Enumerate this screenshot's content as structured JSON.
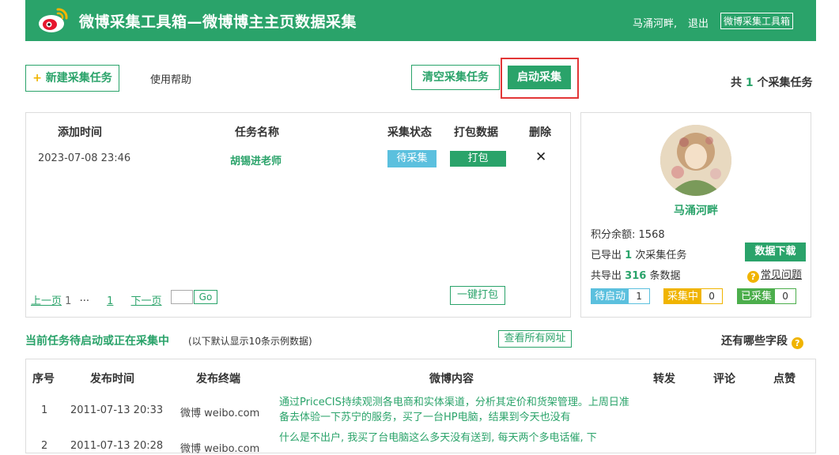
{
  "header": {
    "title": "微博采集工具箱—微博博主主页数据采集",
    "user": "马涌河畔",
    "separator": ",",
    "logout": "退出",
    "toolbox": "微博采集工具箱"
  },
  "toolbar": {
    "new_task_icon": "+",
    "new_task": "新建采集任务",
    "help": "使用帮助",
    "clear": "清空采集任务",
    "start": "启动采集",
    "count_prefix": "共",
    "count": "1",
    "count_suffix": "个采集任务"
  },
  "task_table": {
    "headers": [
      "添加时间",
      "任务名称",
      "采集状态",
      "打包数据",
      "删除"
    ],
    "rows": [
      {
        "time": "2023-07-08 23:46",
        "name": "胡锡进老师",
        "status": "待采集",
        "pack": "打包",
        "delete": "✕"
      }
    ],
    "pager": {
      "prev": "上一页",
      "first": "1",
      "ellipsis": "···",
      "current": "1",
      "next": "下一页",
      "go": "Go"
    },
    "pack_all": "一键打包"
  },
  "profile": {
    "avatar_icon": "avatar",
    "name": "马涌河畔",
    "points_label": "积分余额:",
    "points": "1568",
    "exported_prefix": "已导出",
    "exported_count": "1",
    "exported_suffix": "次采集任务",
    "total_prefix": "共导出",
    "total_count": "316",
    "total_suffix": "条数据",
    "download": "数据下载",
    "faq_icon": "?",
    "faq": "常见问题",
    "chips": [
      {
        "label": "待启动",
        "count": "1",
        "color": "#5bc0de"
      },
      {
        "label": "采集中",
        "count": "0",
        "color": "#f0b400"
      },
      {
        "label": "已采集",
        "count": "0",
        "color": "#4cae4c"
      }
    ]
  },
  "current": {
    "title": "当前任务待启动或正在采集中",
    "note": "(以下默认显示10条示例数据)",
    "view_all": "查看所有网址",
    "fields": "还有哪些字段",
    "fields_icon": "?"
  },
  "posts": {
    "headers": [
      "序号",
      "发布时间",
      "发布终端",
      "微博内容",
      "转发",
      "评论",
      "点赞"
    ],
    "rows": [
      {
        "index": "1",
        "time": "2011-07-13 20:33",
        "device": "微博 weibo.com",
        "content": "通过PriceCIS持续观测各电商和实体渠道，分析其定价和货架管理。上周日准备去体验一下苏宁的服务，买了一台HP电脑，结果到今天也没有"
      },
      {
        "index": "2",
        "time": "2011-07-13 20:28",
        "device": "微博 weibo.com",
        "content": "什么是不出户, 我买了台电脑这么多天没有送到, 每天两个多电话催, 下"
      }
    ]
  },
  "colors": {
    "brand": "#2aa36a",
    "highlight": "#e23636"
  }
}
